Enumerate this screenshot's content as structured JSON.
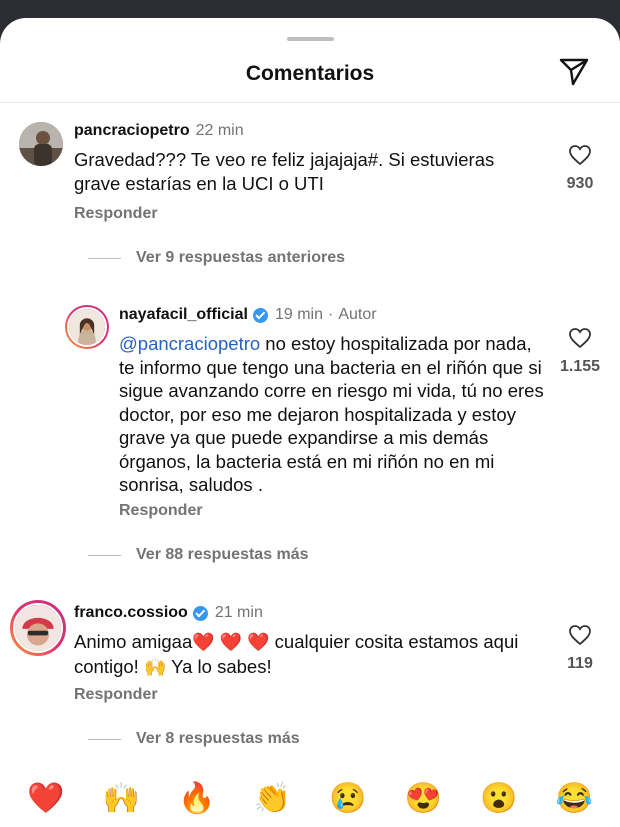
{
  "header": {
    "title": "Comentarios",
    "send_icon": "send-icon"
  },
  "comments": [
    {
      "username": "pancraciopetro",
      "time": "22 min",
      "text": "Gravedad??? Te veo re feliz jajajaja#. Si estuvieras grave estarías en la UCI o UTI",
      "likes": "930",
      "reply": "Responder",
      "more": "Ver 9 respuestas anteriores"
    },
    {
      "username": "nayafacil_official",
      "time": "19 min",
      "separator": "·",
      "author_label": "Autor",
      "mention": "@pancraciopetro",
      "text": " no estoy hospitalizada por nada, te informo que tengo una bacteria en el riñón que si sigue avanzando corre en riesgo mi vida, tú no eres doctor, por eso me dejaron hospitalizada y estoy grave ya que puede expandirse a mis demás órganos, la bacteria está en mi riñón no en mi sonrisa, saludos .",
      "likes": "1.155",
      "reply": "Responder",
      "more": "Ver 88 respuestas más"
    },
    {
      "username": "franco.cossioo",
      "time": "21 min",
      "text_a": "Animo amigaa",
      "hearts": "❤️ ❤️ ❤️",
      "text_b": " cualquier cosita estamos aqui contigo! ",
      "raised_hands": "🙌",
      "text_c": " Ya lo sabes!",
      "likes": "119",
      "reply": "Responder",
      "more": "Ver 8 respuestas más"
    }
  ],
  "emojis": [
    "❤️",
    "🙌",
    "🔥",
    "👏",
    "😢",
    "😍",
    "😮",
    "😂"
  ]
}
